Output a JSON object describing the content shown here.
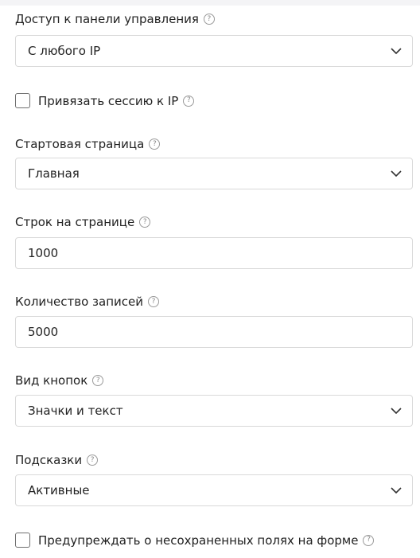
{
  "fields": {
    "access": {
      "label": "Доступ к панели управления",
      "help": "?",
      "value": "С любого IP"
    },
    "bind_session": {
      "label": "Привязать сессию к IP",
      "help": "?",
      "checked": false
    },
    "start_page": {
      "label": "Стартовая страница",
      "help": "?",
      "value": "Главная"
    },
    "rows_per_page": {
      "label": "Строк на странице",
      "help": "?",
      "value": "1000"
    },
    "records_count": {
      "label": "Количество записей",
      "help": "?",
      "value": "5000"
    },
    "button_style": {
      "label": "Вид кнопок",
      "help": "?",
      "value": "Значки и текст"
    },
    "hints": {
      "label": "Подсказки",
      "help": "?",
      "value": "Активные"
    },
    "warn_unsaved": {
      "label": "Предупреждать о несохраненных полях на форме",
      "help": "?",
      "checked": false
    }
  },
  "icons": {
    "help": "question-circle-icon",
    "dropdown": "chevron-down-icon"
  },
  "colors": {
    "border": "#d9d9d9",
    "text": "#222222",
    "help": "#9a9a9a"
  }
}
